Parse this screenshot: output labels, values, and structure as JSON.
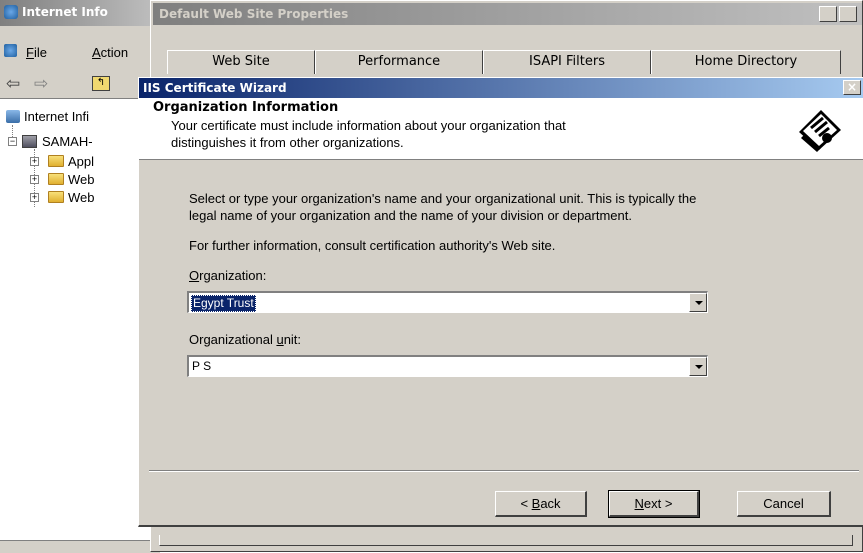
{
  "mmc": {
    "title": "Internet Info",
    "menu": [
      {
        "label": "File",
        "mnemonic": "F",
        "rest": "ile"
      },
      {
        "label": "Action",
        "mnemonic": "A",
        "rest": "ction"
      }
    ],
    "tree": {
      "root": "Internet Infi",
      "server": "SAMAH-",
      "items": [
        "Appl",
        "Web",
        "Web"
      ]
    }
  },
  "properties": {
    "title": "Default Web Site Properties",
    "help_button": "?",
    "close_button": "×",
    "tabs": [
      "Web Site",
      "Performance",
      "ISAPI Filters",
      "Home Directory"
    ]
  },
  "wizard": {
    "title": "IIS Certificate Wizard",
    "close_button": "×",
    "header_title": "Organization Information",
    "header_subtitle_line1": "Your certificate must include information about your organization that",
    "header_subtitle_line2": "distinguishes it from other organizations.",
    "intro_line1": "Select or type your organization's name and your organizational unit. This is typically the",
    "intro_line2": "legal name of your organization and the name of your division or department.",
    "further_info": "For further information, consult certification authority's Web site.",
    "organization": {
      "label_mnemonic": "O",
      "label_rest": "rganization:",
      "value": "Egypt Trust"
    },
    "org_unit": {
      "label_prefix": "Organizational ",
      "label_mnemonic": "u",
      "label_rest": "nit:",
      "value": "P S"
    },
    "buttons": {
      "back_prefix": "< ",
      "back_mnemonic": "B",
      "back_rest": "ack",
      "next_mnemonic": "N",
      "next_rest": "ext >",
      "cancel": "Cancel"
    }
  },
  "colors": {
    "active_title": "#0a246a",
    "inactive_title": "#7f7f7f",
    "dialog_face": "#d4d0c8",
    "selection": "#0a246a"
  }
}
